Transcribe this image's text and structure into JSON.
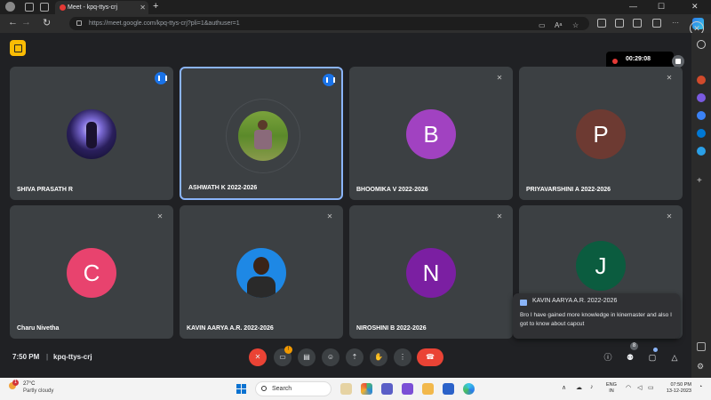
{
  "browser": {
    "tab_title": "Meet - kpq-ttys-crj",
    "url": "https://meet.google.com/kpq-ttys-crj?pli=1&authuser=1",
    "new_tab": "+",
    "min": "—",
    "max": "☐",
    "close": "✕",
    "back": "←",
    "refresh": "↻",
    "read_aloud": "Aᵃ",
    "fav": "☆"
  },
  "meet": {
    "recording_time": "00:29:08",
    "tiles": [
      {
        "name": "SHIVA PRASATH R",
        "type": "photo",
        "status": "speaking"
      },
      {
        "name": "ASHWATH K 2022-2026",
        "type": "photo",
        "status": "speaking"
      },
      {
        "name": "BHOOMIKA V 2022-2026",
        "letter": "B",
        "color": "#a142c1",
        "status": "muted"
      },
      {
        "name": "PRIYAVARSHINI A 2022-2026",
        "letter": "P",
        "color": "#6d3a32",
        "status": "muted"
      },
      {
        "name": "Charu Nivetha",
        "letter": "C",
        "color": "#e8436e",
        "status": "muted"
      },
      {
        "name": "KAVIN AARYA A.R. 2022-2026",
        "type": "photo",
        "status": "muted"
      },
      {
        "name": "NIROSHINI B 2022-2026",
        "letter": "N",
        "color": "#7b1fa2",
        "status": "muted"
      },
      {
        "name": "",
        "letter": "J",
        "color": "#0b5c3f",
        "status": "muted"
      }
    ],
    "chat": {
      "from": "KAVIN AARYA A.R. 2022-2026",
      "message": "Bro I have gained more knowledge in kinemaster and also I got to know about capcut"
    },
    "bottom": {
      "time": "7:50 PM",
      "separator": "|",
      "meeting_code": "kpq-ttys-crj",
      "people_count": "8",
      "camera_alert": "!"
    }
  },
  "taskbar": {
    "weather_badge": "1",
    "temperature": "27°C",
    "weather": "Partly cloudy",
    "search_placeholder": "Search",
    "lang_line1": "ENG",
    "lang_line2": "IN",
    "clock_time": "07:50 PM",
    "clock_date": "13-12-2023"
  }
}
